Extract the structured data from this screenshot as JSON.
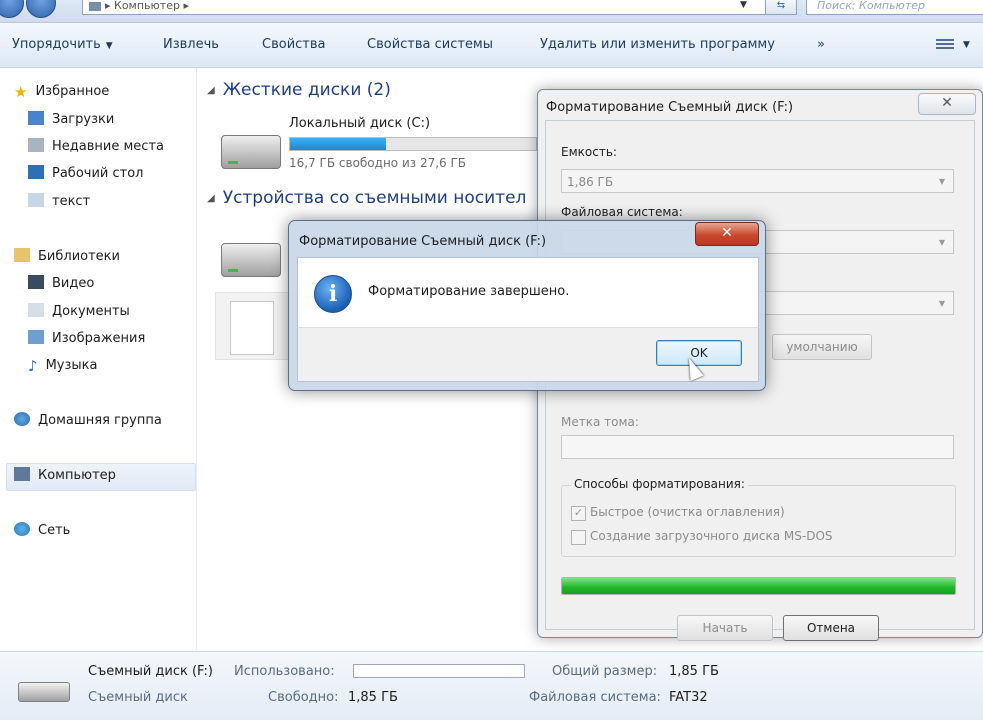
{
  "address_bar": {
    "path": "▸ Компьютер ▸",
    "search_placeholder": "Поиск: Компьютер"
  },
  "toolbar": {
    "organize": "Упорядочить",
    "eject": "Извлечь",
    "properties": "Свойства",
    "system_properties": "Свойства системы",
    "uninstall": "Удалить или изменить программу",
    "more": "»"
  },
  "nav": {
    "favorites": "Избранное",
    "downloads": "Загрузки",
    "recent": "Недавние места",
    "desktop": "Рабочий стол",
    "text": "текст",
    "libraries": "Библиотеки",
    "video": "Видео",
    "documents": "Документы",
    "images": "Изображения",
    "music": "Музыка",
    "homegroup": "Домашняя группа",
    "computer": "Компьютер",
    "network": "Сеть"
  },
  "content": {
    "hdd_header": "Жесткие диски (2)",
    "local_disk_name": "Локальный диск (C:)",
    "local_disk_free": "16,7 ГБ свободно из 27,6 ГБ",
    "local_disk_used_fraction": 0.39,
    "removable_header": "Устройства со съемными носител"
  },
  "format_dialog": {
    "title": "Форматирование Съемный диск (F:)",
    "close_glyph": "✕",
    "capacity_label": "Емкость:",
    "capacity_value": "1,86 ГБ",
    "filesystem_label": "Файловая система:",
    "defaults_button": "умолчанию",
    "volume_label": "Метка тома:",
    "methods_label": "Способы форматирования:",
    "quick_label": "Быстрое (очистка оглавления)",
    "quick_checked": true,
    "msdos_label": "Создание загрузочного диска MS-DOS",
    "msdos_checked": false,
    "progress_fraction": 1.0,
    "start_button": "Начать",
    "cancel_button": "Отмена"
  },
  "message_box": {
    "title": "Форматирование Съемный диск (F:)",
    "close_glyph": "✕",
    "message": "Форматирование завершено.",
    "ok_button": "OK"
  },
  "details": {
    "drive_name": "Съемный диск (F:)",
    "drive_type": "Съемный диск",
    "used_label": "Использовано:",
    "free_label": "Свободно:",
    "free_value": "1,85 ГБ",
    "total_label": "Общий размер:",
    "total_value": "1,85 ГБ",
    "fs_label": "Файловая система:",
    "fs_value": "FAT32"
  },
  "colors": {
    "header_blue": "#1e3f84",
    "progress_green": "#1fb52a",
    "capacity_blue": "#1c86d0",
    "close_red": "#c9482f"
  }
}
